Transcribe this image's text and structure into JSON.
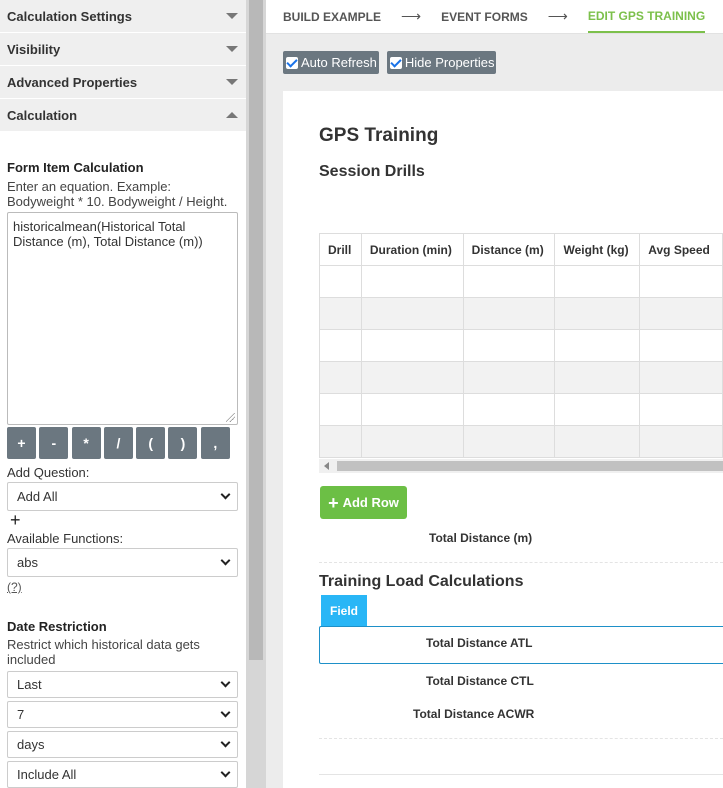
{
  "left_panel": {
    "accordions": [
      {
        "label": "Calculation Settings",
        "expanded": false
      },
      {
        "label": "Visibility",
        "expanded": false
      },
      {
        "label": "Advanced Properties",
        "expanded": false
      },
      {
        "label": "Calculation",
        "expanded": true
      }
    ],
    "form_item_calc": {
      "heading": "Form Item Calculation",
      "help": "Enter an equation. Example: Bodyweight * 10. Bodyweight / Height.",
      "equation": "historicalmean(Historical Total Distance (m), Total Distance (m))",
      "operators": [
        "+",
        "-",
        "*",
        "/",
        "(",
        ")",
        ","
      ]
    },
    "add_question": {
      "label": "Add Question:",
      "value": "Add All",
      "plus": "+"
    },
    "available_functions": {
      "label": "Available Functions:",
      "value": "abs",
      "help_link": "(?)"
    },
    "date_restriction": {
      "heading": "Date Restriction",
      "help": "Restrict which historical data gets included",
      "selects": [
        "Last",
        "7",
        "days",
        "Include All"
      ]
    }
  },
  "breadcrumbs": {
    "items": [
      "BUILD EXAMPLE",
      "EVENT FORMS",
      "EDIT GPS TRAINING"
    ],
    "separator": "⟶"
  },
  "toolbar": {
    "auto_refresh": "Auto Refresh",
    "hide_properties": "Hide Properties"
  },
  "form": {
    "title": "GPS Training",
    "section": "Session Drills",
    "table": {
      "columns": [
        "Drill",
        "Duration (min)",
        "Distance (m)",
        "Weight (kg)",
        "Avg Speed"
      ],
      "row_count": 6
    },
    "add_row": "Add Row",
    "total_distance_label": "Total Distance (m)",
    "training_load": {
      "title": "Training Load Calculations",
      "field_tab": "Field",
      "rows": [
        "Total Distance ATL",
        "Total Distance CTL",
        "Total Distance ACWR"
      ]
    }
  }
}
